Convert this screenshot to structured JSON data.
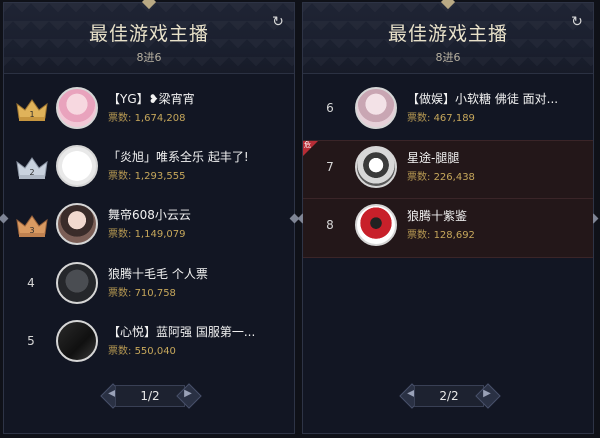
{
  "colors": {
    "panel_bg": "#121623",
    "vote_gold": "#c6a75b",
    "highlight_row": "#231719",
    "red_tag": "#b72d36"
  },
  "panels": [
    {
      "title": "最佳游戏主播",
      "subtitle": "8进6",
      "refresh_icon": "refresh-icon",
      "pager": {
        "text": "1/2",
        "prev_icon": "chevron-left-icon",
        "next_icon": "chevron-right-icon"
      },
      "rows": [
        {
          "rank": "1",
          "crown": "gold",
          "name": "【YG】❥梁宵宵",
          "votes_label": "票数:",
          "votes": "1,674,208"
        },
        {
          "rank": "2",
          "crown": "silver",
          "name": "「炎旭」唯系全乐 起丰了!",
          "votes_label": "票数:",
          "votes": "1,293,555"
        },
        {
          "rank": "3",
          "crown": "bronze",
          "name": "舞帝608小云云",
          "votes_label": "票数:",
          "votes": "1,149,079"
        },
        {
          "rank": "4",
          "crown": "",
          "name": "狼腾十毛毛 个人票",
          "votes_label": "票数:",
          "votes": "710,758"
        },
        {
          "rank": "5",
          "crown": "",
          "name": "【心悦】蓝阿强 国服第一...",
          "votes_label": "票数:",
          "votes": "550,040"
        }
      ]
    },
    {
      "title": "最佳游戏主播",
      "subtitle": "8进6",
      "refresh_icon": "refresh-icon",
      "pager": {
        "text": "2/2",
        "prev_icon": "chevron-left-icon",
        "next_icon": "chevron-right-icon"
      },
      "rows": [
        {
          "rank": "6",
          "name": "【做娱】小软糖 佛徒 面对...",
          "votes_label": "票数:",
          "votes": "467,189"
        },
        {
          "rank": "7",
          "name": "星途-腿腿",
          "votes_label": "票数:",
          "votes": "226,438",
          "tag": "危"
        },
        {
          "rank": "8",
          "name": "狼腾十紫鉴",
          "votes_label": "票数:",
          "votes": "128,692"
        }
      ]
    }
  ]
}
